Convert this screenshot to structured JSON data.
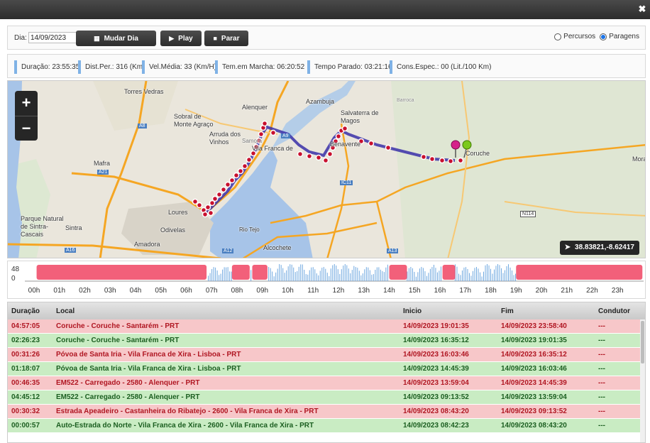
{
  "window": {
    "close_label": "✖"
  },
  "toolbar": {
    "dia_label": "Dia:",
    "dia_value": "14/09/2023",
    "mudar_dia_label": "Mudar Dia",
    "play_label": "Play",
    "parar_label": "Parar",
    "radio_percursos": "Percursos",
    "radio_paragens": "Paragens",
    "selected": "Paragens"
  },
  "stats": [
    "Duração: 23:55:35",
    "Dist.Per.: 316 (Km)",
    "Vel.Média: 33 (Km/H)",
    "Tem.em Marcha: 06:20:52",
    "Tempo Parado: 03:21:16",
    "Cons.Espec.: 00 (Lit./100 Km)"
  ],
  "map": {
    "zoom_in": "+",
    "zoom_out": "−",
    "coords": "38.83821,-8.62417",
    "places": [
      "Torres Vedras",
      "Azambuja",
      "Alenquer",
      "Sobral de",
      "Monte Agraço",
      "Salvaterra de",
      "Magos",
      "Arruda dos",
      "Vinhos",
      "Vila Franca de",
      "Benavente",
      "Coruche",
      "Mafra",
      "Loures",
      "Odivelas",
      "Amadora",
      "Sintra",
      "Parque Natural",
      "de Sintra-",
      "Cascais",
      "Rio Tejo",
      "Alcochete",
      "Mora",
      "Samora",
      "A8",
      "A21",
      "A16",
      "A12",
      "A13",
      "IC11",
      "N114",
      "A9",
      "Barroca"
    ]
  },
  "timeline": {
    "y_max": "48",
    "y_min": "0",
    "hours": [
      "00h",
      "01h",
      "02h",
      "03h",
      "04h",
      "05h",
      "06h",
      "07h",
      "08h",
      "09h",
      "10h",
      "11h",
      "12h",
      "13h",
      "14h",
      "15h",
      "16h",
      "17h",
      "18h",
      "19h",
      "20h",
      "21h",
      "22h",
      "23h"
    ],
    "stop_blocks": [
      [
        0.1,
        6.8
      ],
      [
        7.8,
        8.5
      ],
      [
        8.6,
        9.2
      ],
      [
        14.0,
        14.7
      ],
      [
        16.1,
        16.6
      ],
      [
        19.0,
        23.98
      ]
    ]
  },
  "table": {
    "headers": [
      "Duração",
      "Local",
      "Inicio",
      "Fim",
      "Condutor"
    ],
    "rows": [
      {
        "type": "stop",
        "duracao": "04:57:05",
        "local": "Coruche - Coruche - Santarém - PRT",
        "inicio": "14/09/2023 19:01:35",
        "fim": "14/09/2023 23:58:40",
        "condutor": "---"
      },
      {
        "type": "move",
        "duracao": "02:26:23",
        "local": "Coruche - Coruche - Santarém - PRT",
        "inicio": "14/09/2023 16:35:12",
        "fim": "14/09/2023 19:01:35",
        "condutor": "---"
      },
      {
        "type": "stop",
        "duracao": "00:31:26",
        "local": "Póvoa de Santa Iria - Vila Franca de Xira - Lisboa - PRT",
        "inicio": "14/09/2023 16:03:46",
        "fim": "14/09/2023 16:35:12",
        "condutor": "---"
      },
      {
        "type": "move",
        "duracao": "01:18:07",
        "local": "Póvoa de Santa Iria - Vila Franca de Xira - Lisboa - PRT",
        "inicio": "14/09/2023 14:45:39",
        "fim": "14/09/2023 16:03:46",
        "condutor": "---"
      },
      {
        "type": "stop",
        "duracao": "00:46:35",
        "local": "EM522 - Carregado - 2580 - Alenquer - PRT",
        "inicio": "14/09/2023 13:59:04",
        "fim": "14/09/2023 14:45:39",
        "condutor": "---"
      },
      {
        "type": "move",
        "duracao": "04:45:12",
        "local": "EM522 - Carregado - 2580 - Alenquer - PRT",
        "inicio": "14/09/2023 09:13:52",
        "fim": "14/09/2023 13:59:04",
        "condutor": "---"
      },
      {
        "type": "stop",
        "duracao": "00:30:32",
        "local": "Estrada Apeadeiro - Castanheira do Ribatejo - 2600 - Vila Franca de Xira - PRT",
        "inicio": "14/09/2023 08:43:20",
        "fim": "14/09/2023 09:13:52",
        "condutor": "---"
      },
      {
        "type": "move",
        "duracao": "00:00:57",
        "local": "Auto-Estrada do Norte - Vila Franca de Xira - 2600 - Vila Franca de Xira - PRT",
        "inicio": "14/09/2023 08:42:23",
        "fim": "14/09/2023 08:43:20",
        "condutor": "---"
      }
    ]
  }
}
